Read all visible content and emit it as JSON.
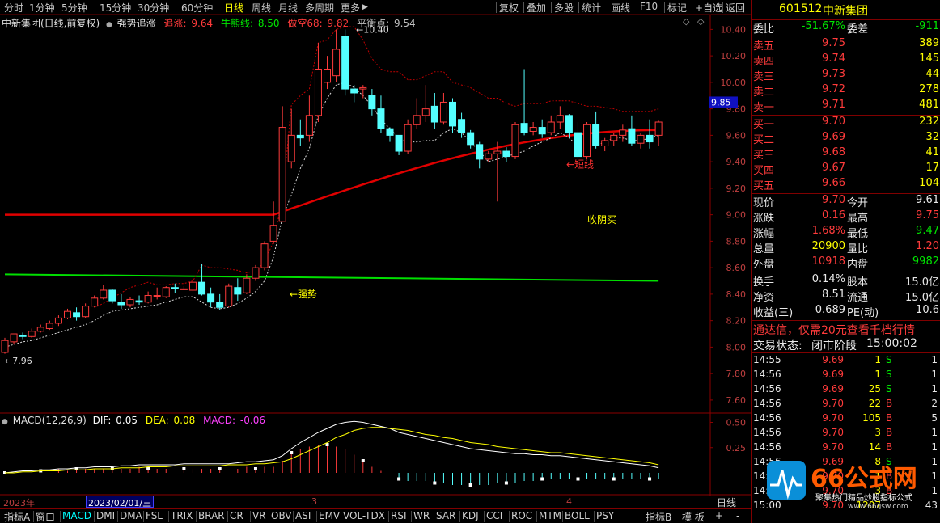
{
  "toolbar": {
    "left_items": [
      "分时",
      "1分钟",
      "5分钟",
      "15分钟",
      "30分钟",
      "60分钟",
      "日线",
      "周线",
      "月线",
      "多周期",
      "更多"
    ],
    "active_index": 6,
    "right_items": [
      "复权",
      "叠加",
      "多股",
      "统计",
      "画线",
      "F10",
      "标记",
      "+自选",
      "返回"
    ]
  },
  "chart_header": {
    "name": "中新集团(日线,前复权)",
    "indicator": "强势追涨",
    "zhuizhang_label": "追涨:",
    "zhuizhang_value": "9.64",
    "niuxiong_label": "牛熊线:",
    "niuxiong_value": "8.50",
    "zuokong_label": "做空68:",
    "zuokong_value": "9.82",
    "pinghengdian_label": "平衡点:",
    "pinghengdian_value": "9.54"
  },
  "chart_data": {
    "type": "candlestick",
    "price_axis_ticks": [
      "10.40",
      "10.20",
      "10.00",
      "9.80",
      "9.60",
      "9.40",
      "9.20",
      "9.00",
      "8.80",
      "8.60",
      "8.40",
      "8.20",
      "8.00",
      "7.80",
      "7.60"
    ],
    "price_ylim": [
      7.52,
      10.5
    ],
    "current_price_marker": "9.85",
    "high_annotation": "10.40",
    "low_annotation": "7.96",
    "annotations": [
      "←短线",
      "收阴买",
      "←强势"
    ],
    "colors": {
      "up": "#ff3b3b",
      "down": "#54ffff",
      "bull_line": "#e00000",
      "bear_line": "#00e000",
      "band": "#c00000"
    },
    "candles": [
      [
        7.96,
        8.07,
        8.05,
        7.95
      ],
      [
        8.04,
        8.1,
        8.1,
        8.02
      ],
      [
        8.09,
        8.11,
        8.08,
        8.06
      ],
      [
        8.08,
        8.14,
        8.12,
        8.07
      ],
      [
        8.12,
        8.17,
        8.15,
        8.11
      ],
      [
        8.14,
        8.2,
        8.18,
        8.13
      ],
      [
        8.18,
        8.24,
        8.22,
        8.16
      ],
      [
        8.22,
        8.29,
        8.27,
        8.21
      ],
      [
        8.26,
        8.3,
        8.23,
        8.2
      ],
      [
        8.23,
        8.33,
        8.31,
        8.22
      ],
      [
        8.31,
        8.39,
        8.37,
        8.3
      ],
      [
        8.37,
        8.47,
        8.43,
        8.36
      ],
      [
        8.43,
        8.44,
        8.35,
        8.33
      ],
      [
        8.34,
        8.4,
        8.32,
        8.29
      ],
      [
        8.32,
        8.38,
        8.36,
        8.3
      ],
      [
        8.35,
        8.39,
        8.34,
        8.32
      ],
      [
        8.34,
        8.42,
        8.39,
        8.33
      ],
      [
        8.39,
        8.45,
        8.39,
        8.36
      ],
      [
        8.38,
        8.46,
        8.45,
        8.37
      ],
      [
        8.45,
        8.48,
        8.44,
        8.41
      ],
      [
        8.44,
        8.46,
        8.44,
        8.43
      ],
      [
        8.43,
        8.5,
        8.49,
        8.42
      ],
      [
        8.49,
        8.63,
        8.4,
        8.39
      ],
      [
        8.4,
        8.45,
        8.34,
        8.3
      ],
      [
        8.34,
        8.4,
        8.3,
        8.28
      ],
      [
        8.31,
        8.48,
        8.46,
        8.3
      ],
      [
        8.45,
        8.52,
        8.4,
        8.35
      ],
      [
        8.41,
        8.55,
        8.52,
        8.4
      ],
      [
        8.52,
        8.62,
        8.6,
        8.5
      ],
      [
        8.6,
        8.8,
        8.78,
        8.58
      ],
      [
        8.8,
        9.1,
        8.92,
        8.78
      ],
      [
        8.95,
        9.82,
        9.66,
        8.95
      ],
      [
        9.4,
        9.8,
        9.6,
        9.35
      ],
      [
        9.6,
        9.72,
        9.58,
        9.52
      ],
      [
        9.6,
        9.9,
        9.75,
        9.55
      ],
      [
        9.75,
        10.3,
        10.1,
        9.7
      ],
      [
        10.0,
        10.2,
        10.1,
        9.95
      ],
      [
        10.05,
        10.4,
        10.25,
        10.0
      ],
      [
        10.35,
        10.4,
        9.95,
        9.9
      ],
      [
        9.95,
        9.98,
        9.92,
        9.85
      ],
      [
        9.95,
        9.98,
        9.96,
        9.88
      ],
      [
        9.9,
        9.95,
        9.8,
        9.75
      ],
      [
        9.8,
        9.9,
        9.65,
        9.62
      ],
      [
        9.65,
        9.66,
        9.6,
        9.55
      ],
      [
        9.6,
        9.6,
        9.48,
        9.45
      ],
      [
        9.48,
        9.72,
        9.68,
        9.46
      ],
      [
        9.68,
        9.88,
        9.75,
        9.65
      ],
      [
        9.75,
        9.98,
        9.8,
        9.7
      ],
      [
        9.82,
        9.92,
        9.7,
        9.65
      ],
      [
        9.7,
        9.92,
        9.85,
        9.68
      ],
      [
        9.85,
        9.88,
        9.67,
        9.62
      ],
      [
        9.72,
        9.77,
        9.62,
        9.58
      ],
      [
        9.62,
        9.64,
        9.53,
        9.5
      ],
      [
        9.53,
        9.55,
        9.42,
        9.35
      ],
      [
        9.42,
        9.48,
        9.46,
        9.4
      ],
      [
        9.46,
        9.55,
        9.48,
        9.1
      ],
      [
        9.48,
        9.51,
        9.44,
        9.4
      ],
      [
        9.44,
        9.7,
        9.68,
        9.42
      ],
      [
        9.69,
        10.1,
        9.62,
        9.6
      ],
      [
        9.63,
        9.7,
        9.66,
        9.6
      ],
      [
        9.66,
        9.72,
        9.61,
        9.58
      ],
      [
        9.62,
        9.75,
        9.7,
        9.6
      ],
      [
        9.7,
        9.82,
        9.75,
        9.65
      ],
      [
        9.75,
        9.76,
        9.62,
        9.58
      ],
      [
        9.62,
        9.7,
        9.44,
        9.4
      ],
      [
        9.44,
        9.7,
        9.68,
        9.42
      ],
      [
        9.68,
        9.78,
        9.52,
        9.5
      ],
      [
        9.52,
        9.58,
        9.56,
        9.48
      ],
      [
        9.56,
        9.62,
        9.6,
        9.52
      ],
      [
        9.6,
        9.68,
        9.64,
        9.55
      ],
      [
        9.65,
        9.75,
        9.54,
        9.52
      ],
      [
        9.54,
        9.62,
        9.6,
        9.5
      ],
      [
        9.6,
        9.72,
        9.55,
        9.5
      ],
      [
        9.6,
        9.71,
        9.7,
        9.52
      ]
    ],
    "zhuizhang_line": [
      8.0,
      8.02,
      8.04,
      8.05,
      8.07,
      8.09,
      8.11,
      8.13,
      8.15,
      8.17,
      8.2,
      8.24,
      8.27,
      8.28,
      8.29,
      8.3,
      8.31,
      8.32,
      8.34,
      8.36,
      8.38,
      8.38,
      8.34,
      8.3,
      8.29,
      8.3,
      8.33,
      8.37,
      8.42,
      8.5,
      8.68,
      8.98,
      9.15,
      9.35,
      9.5,
      9.75,
      9.88,
      9.98,
      10.0,
      9.96,
      9.9,
      9.82,
      9.72,
      9.65,
      9.58,
      9.55,
      9.55,
      9.56,
      9.56,
      9.62,
      9.65,
      9.62,
      9.55,
      9.48,
      9.4,
      9.42,
      9.44,
      9.46,
      9.48,
      9.52,
      9.55,
      9.58,
      9.62,
      9.58,
      9.52,
      9.52,
      9.52,
      9.55,
      9.58,
      9.58,
      9.56,
      9.56,
      9.58,
      9.6
    ],
    "band_upper": [
      null,
      null,
      null,
      null,
      null,
      null,
      null,
      null,
      null,
      null,
      8.3,
      8.33,
      8.37,
      8.41,
      8.45,
      8.47,
      8.49,
      8.47,
      8.47,
      8.48,
      8.48,
      8.5,
      8.62,
      8.6,
      8.6,
      8.59,
      8.58,
      8.56,
      8.58,
      8.64,
      8.8,
      9.12,
      9.83,
      9.9,
      9.95,
      10.3,
      10.32,
      10.4,
      10.42,
      10.42,
      10.32,
      10.18,
      10.1,
      10.08,
      10.08,
      10.02,
      10.02,
      10.05,
      10.08,
      10.08,
      10.0,
      9.98,
      9.96,
      9.92,
      9.88,
      9.88,
      9.84,
      9.82,
      9.84,
      9.84,
      9.84,
      9.86,
      9.86,
      9.86,
      9.84,
      9.82,
      9.82,
      9.81,
      9.8,
      9.78,
      9.78,
      9.78,
      9.78,
      9.8
    ],
    "bull_line_start": 9.0,
    "bull_line_end": 9.64,
    "bear_line_start": 8.55,
    "bear_line_end": 8.5,
    "macd": {
      "header": "MACD(12,26,9)",
      "dif_label": "DIF:",
      "dif_value": "0.05",
      "dea_label": "DEA:",
      "dea_value": "0.08",
      "macd_label": "MACD:",
      "macd_value": "-0.06",
      "axis_ticks": [
        "0.50",
        "0.25"
      ],
      "ylim": [
        -0.2,
        0.56
      ],
      "dif": [
        0.0,
        0.01,
        0.02,
        0.02,
        0.03,
        0.03,
        0.04,
        0.04,
        0.05,
        0.05,
        0.06,
        0.06,
        0.06,
        0.07,
        0.07,
        0.08,
        0.08,
        0.08,
        0.08,
        0.08,
        0.09,
        0.09,
        0.09,
        0.09,
        0.09,
        0.09,
        0.1,
        0.11,
        0.11,
        0.12,
        0.13,
        0.17,
        0.24,
        0.3,
        0.35,
        0.4,
        0.44,
        0.48,
        0.5,
        0.51,
        0.5,
        0.48,
        0.46,
        0.44,
        0.4,
        0.38,
        0.36,
        0.34,
        0.32,
        0.3,
        0.28,
        0.26,
        0.24,
        0.23,
        0.22,
        0.21,
        0.2,
        0.19,
        0.19,
        0.18,
        0.18,
        0.17,
        0.17,
        0.16,
        0.15,
        0.14,
        0.13,
        0.12,
        0.11,
        0.1,
        0.09,
        0.08,
        0.07,
        0.05
      ],
      "dea": [
        0.0,
        0.0,
        0.01,
        0.01,
        0.02,
        0.02,
        0.02,
        0.03,
        0.03,
        0.03,
        0.04,
        0.04,
        0.04,
        0.05,
        0.05,
        0.05,
        0.06,
        0.06,
        0.06,
        0.07,
        0.07,
        0.07,
        0.07,
        0.07,
        0.07,
        0.08,
        0.08,
        0.08,
        0.09,
        0.09,
        0.1,
        0.11,
        0.14,
        0.18,
        0.22,
        0.26,
        0.3,
        0.35,
        0.38,
        0.42,
        0.44,
        0.45,
        0.45,
        0.44,
        0.43,
        0.42,
        0.4,
        0.38,
        0.37,
        0.35,
        0.34,
        0.32,
        0.3,
        0.29,
        0.28,
        0.26,
        0.25,
        0.24,
        0.23,
        0.22,
        0.21,
        0.2,
        0.2,
        0.19,
        0.18,
        0.17,
        0.16,
        0.15,
        0.14,
        0.13,
        0.12,
        0.11,
        0.1,
        0.08
      ]
    }
  },
  "date_axis": {
    "labels": [
      "2023年",
      "3",
      "4"
    ],
    "cursor_date": "2023/02/01/三",
    "period": "日线"
  },
  "bottom_tabs": [
    "指标A",
    "窗口",
    "MACD",
    "DMI",
    "DMA",
    "FSL",
    "TRIX",
    "BRAR",
    "CR",
    "VR",
    "OBV",
    "ASI",
    "EMV",
    "VOL-TDX",
    "RSI",
    "WR",
    "SAR",
    "KDJ",
    "CCI",
    "ROC",
    "MTM",
    "BOLL",
    "PSY"
  ],
  "bottom_tabs_active": 2,
  "bottom_right": [
    "指标B",
    "模 板",
    "+",
    "-"
  ],
  "panel": {
    "code": "601512",
    "name": "中新集团",
    "weibi_label": "委比",
    "weibi_value": "-51.67%",
    "weicha_label": "委差",
    "weicha_value": "-911",
    "asks": [
      {
        "label": "卖五",
        "price": "9.75",
        "vol": "389"
      },
      {
        "label": "卖四",
        "price": "9.74",
        "vol": "145"
      },
      {
        "label": "卖三",
        "price": "9.73",
        "vol": "44"
      },
      {
        "label": "卖二",
        "price": "9.72",
        "vol": "278"
      },
      {
        "label": "卖一",
        "price": "9.71",
        "vol": "481"
      }
    ],
    "bids": [
      {
        "label": "买一",
        "price": "9.70",
        "vol": "232"
      },
      {
        "label": "买二",
        "price": "9.69",
        "vol": "32"
      },
      {
        "label": "买三",
        "price": "9.68",
        "vol": "41"
      },
      {
        "label": "买四",
        "price": "9.67",
        "vol": "17"
      },
      {
        "label": "买五",
        "price": "9.66",
        "vol": "104"
      }
    ],
    "stats": [
      {
        "l1": "现价",
        "v1": "9.70",
        "c1": "red",
        "l2": "今开",
        "v2": "9.61",
        "c2": "white"
      },
      {
        "l1": "涨跌",
        "v1": "0.16",
        "c1": "red",
        "l2": "最高",
        "v2": "9.75",
        "c2": "red"
      },
      {
        "l1": "涨幅",
        "v1": "1.68%",
        "c1": "red",
        "l2": "最低",
        "v2": "9.47",
        "c2": "green"
      },
      {
        "l1": "总量",
        "v1": "20900",
        "c1": "yellow",
        "l2": "量比",
        "v2": "1.20",
        "c2": "red"
      },
      {
        "l1": "外盘",
        "v1": "10918",
        "c1": "red",
        "l2": "内盘",
        "v2": "9982",
        "c2": "green"
      }
    ],
    "stats2": [
      {
        "l1": "换手",
        "v1": "0.14%",
        "l2": "股本",
        "v2": "15.0亿"
      },
      {
        "l1": "净资",
        "v1": "8.51",
        "l2": "流通",
        "v2": "15.0亿"
      },
      {
        "l1": "收益(三)",
        "v1": "0.689",
        "l2": "PE(动)",
        "v2": "10.6"
      }
    ],
    "promo": "通达信，仅需20元查看千档行情",
    "trade_status_label": "交易状态:",
    "trade_status_value": "闭市阶段",
    "trade_status_time": "15:00:02",
    "ticks": [
      {
        "time": "14:55",
        "price": "9.69",
        "vol": "1",
        "side": "S",
        "n": "1"
      },
      {
        "time": "14:56",
        "price": "9.69",
        "vol": "1",
        "side": "S",
        "n": "1"
      },
      {
        "time": "14:56",
        "price": "9.69",
        "vol": "25",
        "side": "S",
        "n": "1"
      },
      {
        "time": "14:56",
        "price": "9.70",
        "vol": "22",
        "side": "B",
        "n": "2"
      },
      {
        "time": "14:56",
        "price": "9.70",
        "vol": "105",
        "side": "B",
        "n": "5"
      },
      {
        "time": "14:56",
        "price": "9.70",
        "vol": "3",
        "side": "B",
        "n": "1"
      },
      {
        "time": "14:56",
        "price": "9.70",
        "vol": "14",
        "side": "B",
        "n": "1"
      },
      {
        "time": "14:56",
        "price": "9.69",
        "vol": "8",
        "side": "S",
        "n": "1"
      },
      {
        "time": "14:57",
        "price": "9.70",
        "vol": "1",
        "side": "B",
        "n": "1"
      },
      {
        "time": "14:57",
        "price": "9.70",
        "vol": "3",
        "side": "B",
        "n": "1"
      },
      {
        "time": "15:00",
        "price": "9.70",
        "vol": "1207",
        "side": "",
        "n": "43"
      }
    ]
  },
  "watermark": {
    "brand": "66公式网",
    "line1": "聚集热门精品炒股指标公式",
    "line2": "www.66gsw.com"
  }
}
